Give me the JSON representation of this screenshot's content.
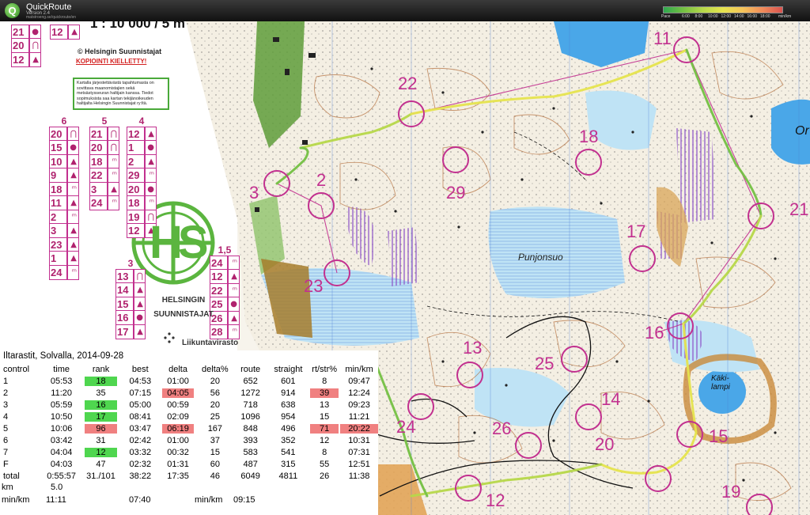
{
  "app": {
    "icon_letter": "Q",
    "title": "QuickRoute",
    "version": "Version 2.4",
    "url": "matstroeng.se/quickroute/en",
    "pace_label": "Pace",
    "pace_unit": "min/km",
    "pace_ticks": [
      "6:00",
      "8:00",
      "10:00",
      "12:00",
      "14:00",
      "16:00",
      "18:00"
    ],
    "pace_colors": [
      "#2fa84f",
      "#74c043",
      "#b7d84a",
      "#e6e44e",
      "#f4c45a",
      "#f08b5a",
      "#d9534f"
    ]
  },
  "map": {
    "scale_text": "1 : 10 000 / 5 m",
    "copyright": "© Helsingin Suunnistajat",
    "copy_warning": "KOPIOINTI KIELLETTY!",
    "notice": "Kartalla järjestettävästä tapahtumasta on sovittava maanomistajien sekä metsästysseuran haltijain kanssa. Tiedot sopimuksista saa kartan tekijänoikeuden haltijalta Helsingin Suunnistajat ry:ltä.",
    "club_logo_text": "HS",
    "club_name": "HELSINGIN SUUNNISTAJAT",
    "agency": "Liikuntavirasto",
    "place_names": [
      "Punjonsuo",
      "Käki-lampi",
      "Or"
    ],
    "controls": [
      {
        "label": "22"
      },
      {
        "label": "11"
      },
      {
        "label": "18"
      },
      {
        "label": "29"
      },
      {
        "label": "2"
      },
      {
        "label": "3"
      },
      {
        "label": "17"
      },
      {
        "label": "21"
      },
      {
        "label": "16"
      },
      {
        "label": "23"
      },
      {
        "label": "25"
      },
      {
        "label": "13"
      },
      {
        "label": "14"
      },
      {
        "label": "26"
      },
      {
        "label": "20"
      },
      {
        "label": "12"
      },
      {
        "label": "15"
      },
      {
        "label": "19"
      },
      {
        "label": "24"
      }
    ],
    "desc_columns": [
      {
        "header": "6",
        "rows": [
          {
            "n": "20",
            "s": "⋂"
          },
          {
            "n": "15",
            "s": "●"
          },
          {
            "n": "10",
            "s": "▲"
          },
          {
            "n": "9",
            "s": "▲"
          },
          {
            "n": "18",
            "s": "ᵐ"
          },
          {
            "n": "11",
            "s": "▲"
          },
          {
            "n": "2",
            "s": "ᵐ"
          },
          {
            "n": "3",
            "s": "▲"
          },
          {
            "n": "23",
            "s": "▲"
          },
          {
            "n": "1",
            "s": "▲"
          },
          {
            "n": "24",
            "s": "ᵐ"
          }
        ]
      },
      {
        "header": "5",
        "rows": [
          {
            "n": "21",
            "s": "⋂"
          },
          {
            "n": "20",
            "s": "⋂"
          },
          {
            "n": "18",
            "s": "ᵐ"
          },
          {
            "n": "22",
            "s": "ᵐ"
          },
          {
            "n": "3",
            "s": "▲"
          },
          {
            "n": "24",
            "s": "ᵐ"
          }
        ]
      },
      {
        "header": "4",
        "rows": [
          {
            "n": "12",
            "s": "▲"
          },
          {
            "n": "1",
            "s": "●"
          },
          {
            "n": "2",
            "s": "▲"
          },
          {
            "n": "29",
            "s": "ᵐ"
          },
          {
            "n": "20",
            "s": "●"
          },
          {
            "n": "18",
            "s": "ᵐ"
          },
          {
            "n": "19",
            "s": "⋂"
          },
          {
            "n": "12",
            "s": "▲"
          }
        ]
      },
      {
        "header": "3",
        "rows": [
          {
            "n": "13",
            "s": "⋂"
          },
          {
            "n": "14",
            "s": "▲"
          },
          {
            "n": "15",
            "s": "▲"
          },
          {
            "n": "16",
            "s": "●"
          },
          {
            "n": "17",
            "s": "▲"
          }
        ]
      },
      {
        "header": "1,5",
        "rows": [
          {
            "n": "24",
            "s": "ᵐ"
          },
          {
            "n": "12",
            "s": "▲"
          },
          {
            "n": "22",
            "s": "ᵐ"
          },
          {
            "n": "25",
            "s": "●"
          },
          {
            "n": "26",
            "s": "▲"
          },
          {
            "n": "28",
            "s": "ᵐ"
          }
        ]
      }
    ],
    "top_col": [
      {
        "n": "21",
        "s": "●"
      },
      {
        "n": "20",
        "s": "⋂"
      },
      {
        "n": "12",
        "s": "▲"
      }
    ],
    "top_col2": [
      {
        "n": "12",
        "s": "▲"
      }
    ]
  },
  "results": {
    "title": "Iltarastit, Solvalla, 2014-09-28",
    "columns": [
      "control",
      "time",
      "rank",
      "best",
      "delta",
      "delta%",
      "route",
      "straight",
      "rt/str%",
      "min/km"
    ],
    "rows": [
      {
        "control": "1",
        "time": "05:53",
        "rank": "18",
        "best": "04:53",
        "delta": "01:00",
        "delta_pct": "20",
        "route": "652",
        "straight": "601",
        "rt_str": "8",
        "min_km": "09:47",
        "rank_hl": "green",
        "delta_hl": "",
        "rt_hl": "",
        "mk_hl": ""
      },
      {
        "control": "2",
        "time": "11:20",
        "rank": "35",
        "best": "07:15",
        "delta": "04:05",
        "delta_pct": "56",
        "route": "1272",
        "straight": "914",
        "rt_str": "39",
        "min_km": "12:24",
        "rank_hl": "",
        "delta_hl": "red",
        "rt_hl": "red",
        "mk_hl": ""
      },
      {
        "control": "3",
        "time": "05:59",
        "rank": "16",
        "best": "05:00",
        "delta": "00:59",
        "delta_pct": "20",
        "route": "718",
        "straight": "638",
        "rt_str": "13",
        "min_km": "09:23",
        "rank_hl": "green",
        "delta_hl": "",
        "rt_hl": "",
        "mk_hl": ""
      },
      {
        "control": "4",
        "time": "10:50",
        "rank": "17",
        "best": "08:41",
        "delta": "02:09",
        "delta_pct": "25",
        "route": "1096",
        "straight": "954",
        "rt_str": "15",
        "min_km": "11:21",
        "rank_hl": "green",
        "delta_hl": "",
        "rt_hl": "",
        "mk_hl": ""
      },
      {
        "control": "5",
        "time": "10:06",
        "rank": "96",
        "best": "03:47",
        "delta": "06:19",
        "delta_pct": "167",
        "route": "848",
        "straight": "496",
        "rt_str": "71",
        "min_km": "20:22",
        "rank_hl": "red",
        "delta_hl": "red",
        "rt_hl": "red",
        "mk_hl": "red"
      },
      {
        "control": "6",
        "time": "03:42",
        "rank": "31",
        "best": "02:42",
        "delta": "01:00",
        "delta_pct": "37",
        "route": "393",
        "straight": "352",
        "rt_str": "12",
        "min_km": "10:31",
        "rank_hl": "",
        "delta_hl": "",
        "rt_hl": "",
        "mk_hl": ""
      },
      {
        "control": "7",
        "time": "04:04",
        "rank": "12",
        "best": "03:32",
        "delta": "00:32",
        "delta_pct": "15",
        "route": "583",
        "straight": "541",
        "rt_str": "8",
        "min_km": "07:31",
        "rank_hl": "green",
        "delta_hl": "",
        "rt_hl": "",
        "mk_hl": ""
      },
      {
        "control": "F",
        "time": "04:03",
        "rank": "47",
        "best": "02:32",
        "delta": "01:31",
        "delta_pct": "60",
        "route": "487",
        "straight": "315",
        "rt_str": "55",
        "min_km": "12:51",
        "rank_hl": "",
        "delta_hl": "",
        "rt_hl": "",
        "mk_hl": ""
      },
      {
        "control": "total",
        "time": "0:55:57",
        "rank": "31./101",
        "best": "38:22",
        "delta": "17:35",
        "delta_pct": "46",
        "route": "6049",
        "straight": "4811",
        "rt_str": "26",
        "min_km": "11:38",
        "rank_hl": "",
        "delta_hl": "",
        "rt_hl": "",
        "mk_hl": ""
      }
    ],
    "km_label": "km",
    "km_value": "5.0",
    "minkm_label": "min/km",
    "minkm_value": "11:11",
    "best_minkm": "07:40",
    "winner_minkm_label": "min/km",
    "winner_minkm_value": "09:15"
  }
}
